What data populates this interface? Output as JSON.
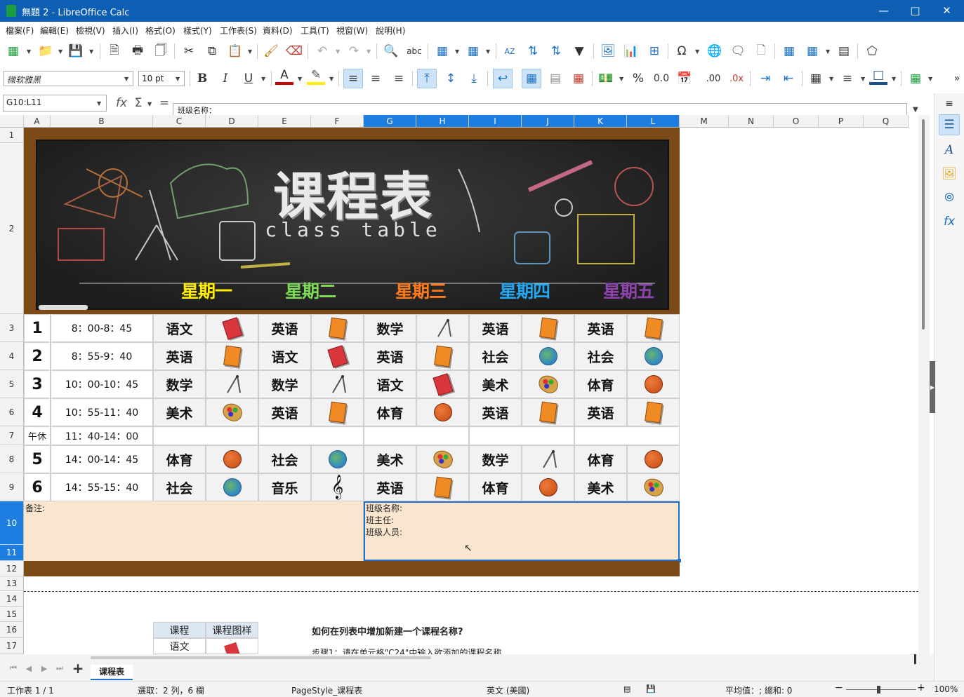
{
  "window": {
    "title": "無題 2 - LibreOffice Calc"
  },
  "menu": [
    "檔案(F)",
    "編輯(E)",
    "檢視(V)",
    "插入(I)",
    "格式(O)",
    "樣式(Y)",
    "工作表(S)",
    "資料(D)",
    "工具(T)",
    "視窗(W)",
    "說明(H)"
  ],
  "format": {
    "font_name": "微软雅黑",
    "font_size": "10 pt"
  },
  "formula": {
    "name_box": "G10:L11",
    "content": "班级名称："
  },
  "columns": [
    "A",
    "B",
    "C",
    "D",
    "E",
    "F",
    "G",
    "H",
    "I",
    "J",
    "K",
    "L",
    "M",
    "N",
    "O",
    "P",
    "Q"
  ],
  "rows": [
    "1",
    "2",
    "3",
    "4",
    "5",
    "6",
    "7",
    "8",
    "9",
    "10",
    "11",
    "12",
    "13",
    "14",
    "15",
    "16",
    "17"
  ],
  "banner": {
    "title": "课程表",
    "subtitle": "class table"
  },
  "days": [
    "星期一",
    "星期二",
    "星期三",
    "星期四",
    "星期五"
  ],
  "colors": {
    "day1": "#ffee00",
    "day2": "#7ed957",
    "day3": "#ff7a1a",
    "day4": "#22a7f0",
    "day5": "#8e44ad",
    "frame": "#7b4a17",
    "notes_bg": "#fae6cf",
    "selection": "#1e7de0"
  },
  "schedule": [
    {
      "num": "1",
      "time": "8：00-8：45",
      "subjects": [
        {
          "name": "语文",
          "icon": "book-red"
        },
        {
          "name": "英语",
          "icon": "book-orange"
        },
        {
          "name": "数学",
          "icon": "compass"
        },
        {
          "name": "英语",
          "icon": "book-orange"
        },
        {
          "name": "英语",
          "icon": "book-orange"
        }
      ]
    },
    {
      "num": "2",
      "time": "8：55-9：40",
      "subjects": [
        {
          "name": "英语",
          "icon": "book-orange"
        },
        {
          "name": "语文",
          "icon": "book-red"
        },
        {
          "name": "英语",
          "icon": "book-orange"
        },
        {
          "name": "社会",
          "icon": "globe"
        },
        {
          "name": "社会",
          "icon": "globe"
        }
      ]
    },
    {
      "num": "3",
      "time": "10：00-10：45",
      "subjects": [
        {
          "name": "数学",
          "icon": "compass"
        },
        {
          "name": "数学",
          "icon": "compass"
        },
        {
          "name": "语文",
          "icon": "book-red"
        },
        {
          "name": "美术",
          "icon": "palette"
        },
        {
          "name": "体育",
          "icon": "basketball"
        }
      ]
    },
    {
      "num": "4",
      "time": "10：55-11：40",
      "subjects": [
        {
          "name": "美术",
          "icon": "palette"
        },
        {
          "name": "英语",
          "icon": "book-orange"
        },
        {
          "name": "体育",
          "icon": "basketball"
        },
        {
          "name": "英语",
          "icon": "book-orange"
        },
        {
          "name": "英语",
          "icon": "book-orange"
        }
      ]
    }
  ],
  "lunch": {
    "label": "午休",
    "time": "11：40-14：00"
  },
  "schedule_pm": [
    {
      "num": "5",
      "time": "14：00-14：45",
      "subjects": [
        {
          "name": "体育",
          "icon": "basketball"
        },
        {
          "name": "社会",
          "icon": "globe"
        },
        {
          "name": "美术",
          "icon": "palette"
        },
        {
          "name": "数学",
          "icon": "compass"
        },
        {
          "name": "体育",
          "icon": "basketball"
        }
      ]
    },
    {
      "num": "6",
      "time": "14：55-15：40",
      "subjects": [
        {
          "name": "社会",
          "icon": "globe"
        },
        {
          "name": "音乐",
          "icon": "treble-clef"
        },
        {
          "name": "英语",
          "icon": "book-orange"
        },
        {
          "name": "体育",
          "icon": "basketball"
        },
        {
          "name": "美术",
          "icon": "palette"
        }
      ]
    }
  ],
  "notes": {
    "label": "备注:",
    "class_name": "班级名称:",
    "teacher": "班主任:",
    "members": "班级人员:"
  },
  "course_list": {
    "header_course": "课程",
    "header_icon": "课程图样",
    "first": "语文"
  },
  "help": {
    "title": "如何在列表中增加新建一个课程名称?",
    "step1": "步骤1：请在单元格\"C24\"中输入欲添加的课程名称"
  },
  "sheet_tab": "课程表",
  "status": {
    "sheet": "工作表 1 / 1",
    "selection": "選取：2 列，6 欄",
    "page_style": "PageStyle_课程表",
    "language": "英文 (美國)",
    "summary": "平均值：; 總和: 0",
    "zoom": "100%"
  }
}
